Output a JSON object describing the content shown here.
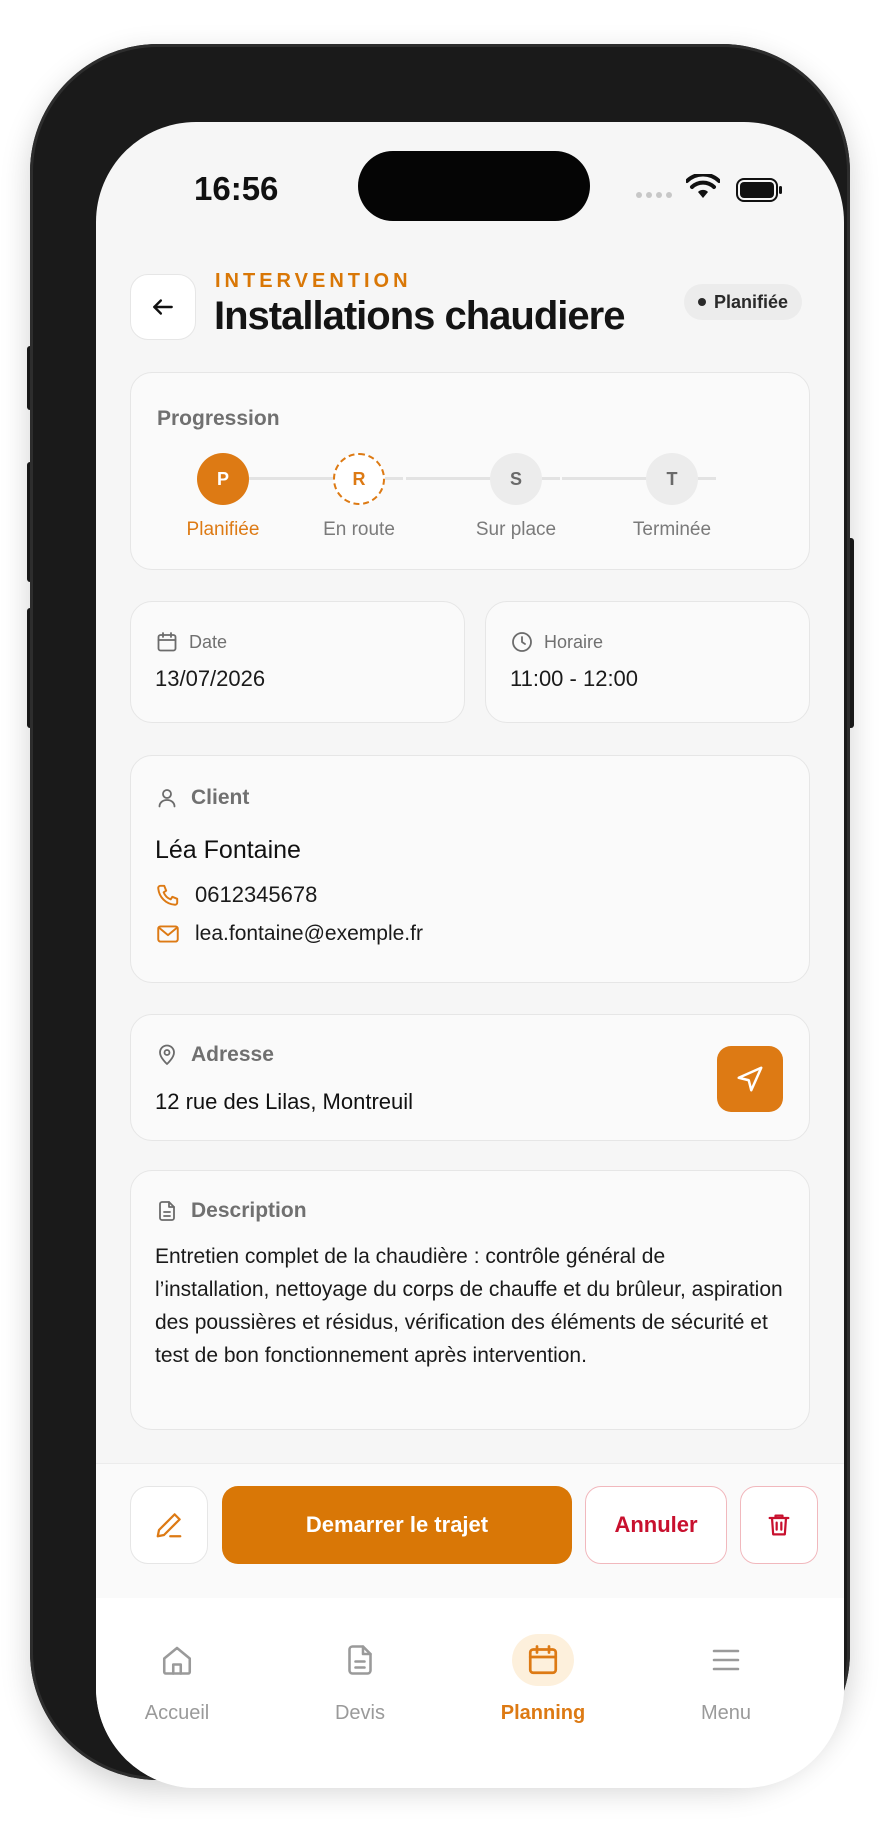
{
  "status_bar": {
    "time": "16:56"
  },
  "header": {
    "kicker": "INTERVENTION",
    "title": "Installations chaudiere",
    "status": "Planifiée"
  },
  "progress": {
    "label": "Progression",
    "steps": [
      {
        "letter": "P",
        "label": "Planifiée",
        "state": "done"
      },
      {
        "letter": "R",
        "label": "En route",
        "state": "next"
      },
      {
        "letter": "S",
        "label": "Sur place",
        "state": "todo"
      },
      {
        "letter": "T",
        "label": "Terminée",
        "state": "todo"
      }
    ]
  },
  "date": {
    "label": "Date",
    "value": "13/07/2026"
  },
  "schedule": {
    "label": "Horaire",
    "value": "11:00 - 12:00"
  },
  "client": {
    "label": "Client",
    "name": "Léa Fontaine",
    "phone": "0612345678",
    "email": "lea.fontaine@exemple.fr"
  },
  "address": {
    "label": "Adresse",
    "value": "12 rue des Lilas, Montreuil"
  },
  "description": {
    "label": "Description",
    "text": "Entretien complet de la chaudière : contrôle général de l’installation, nettoyage du corps de chauffe et du brûleur, aspiration des poussières et résidus, vérification des éléments de sécurité et test de bon fonctionnement après intervention."
  },
  "actions": {
    "start": "Demarrer le trajet",
    "cancel": "Annuler"
  },
  "tabs": [
    {
      "label": "Accueil",
      "icon": "home-icon",
      "active": false
    },
    {
      "label": "Devis",
      "icon": "document-icon",
      "active": false
    },
    {
      "label": "Planning",
      "icon": "calendar-icon",
      "active": true
    },
    {
      "label": "Menu",
      "icon": "menu-icon",
      "active": false
    }
  ],
  "colors": {
    "accent": "#dd7a14",
    "danger": "#c8102e",
    "background": "#f6f6f6"
  }
}
